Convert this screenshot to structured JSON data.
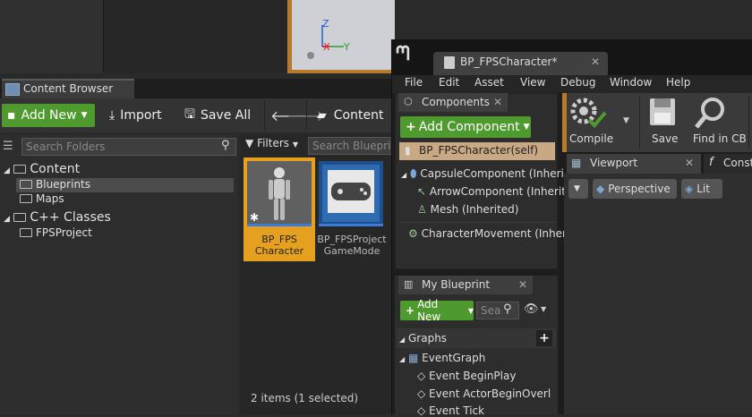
{
  "viewport_axes": {
    "z": "Z",
    "x": "X",
    "y": "Y"
  },
  "content_browser": {
    "tab_title": "Content Browser",
    "add_new": "Add New",
    "import": "Import",
    "save_all": "Save All",
    "path_root": "Content",
    "search_folders_placeholder": "Search Folders",
    "filters": "Filters",
    "search_blueprints_placeholder": "Search Blueprint",
    "tree": {
      "content": "Content",
      "blueprints": "Blueprints",
      "maps": "Maps",
      "cpp_classes": "C++ Classes",
      "fpsproject": "FPSProject"
    },
    "assets": [
      {
        "line1": "BP_FPS",
        "line2": "Character"
      },
      {
        "line1": "BP_FPSProject",
        "line2": "GameMode"
      }
    ],
    "status": "2 items (1 selected)"
  },
  "blueprint_editor": {
    "tab_title": "BP_FPSCharacter*",
    "menu": [
      "File",
      "Edit",
      "Asset",
      "View",
      "Debug",
      "Window",
      "Help"
    ],
    "components": {
      "tab_title": "Components",
      "add_component": "Add Component",
      "items": {
        "self": "BP_FPSCharacter(self)",
        "capsule": "CapsuleComponent (Inherit",
        "arrow": "ArrowComponent (Inherit",
        "mesh": "Mesh (Inherited)",
        "movement": "CharacterMovement (Inheri"
      }
    },
    "my_blueprint": {
      "tab_title": "My Blueprint",
      "add_new": "Add New",
      "search_placeholder": "Sea",
      "graphs_label": "Graphs",
      "event_graph": "EventGraph",
      "events": [
        "Event BeginPlay",
        "Event ActorBeginOverl",
        "Event Tick"
      ]
    },
    "toolbar": {
      "compile": "Compile",
      "save": "Save",
      "find_in_cb": "Find in CB"
    },
    "viewport": {
      "tab_title": "Viewport",
      "construction_tab": "Const",
      "perspective": "Perspective",
      "lit": "Lit"
    }
  },
  "colors": {
    "accent_green": "#4e9a2e",
    "selection_orange": "#e6a020",
    "selection_tan": "#c8a984"
  }
}
